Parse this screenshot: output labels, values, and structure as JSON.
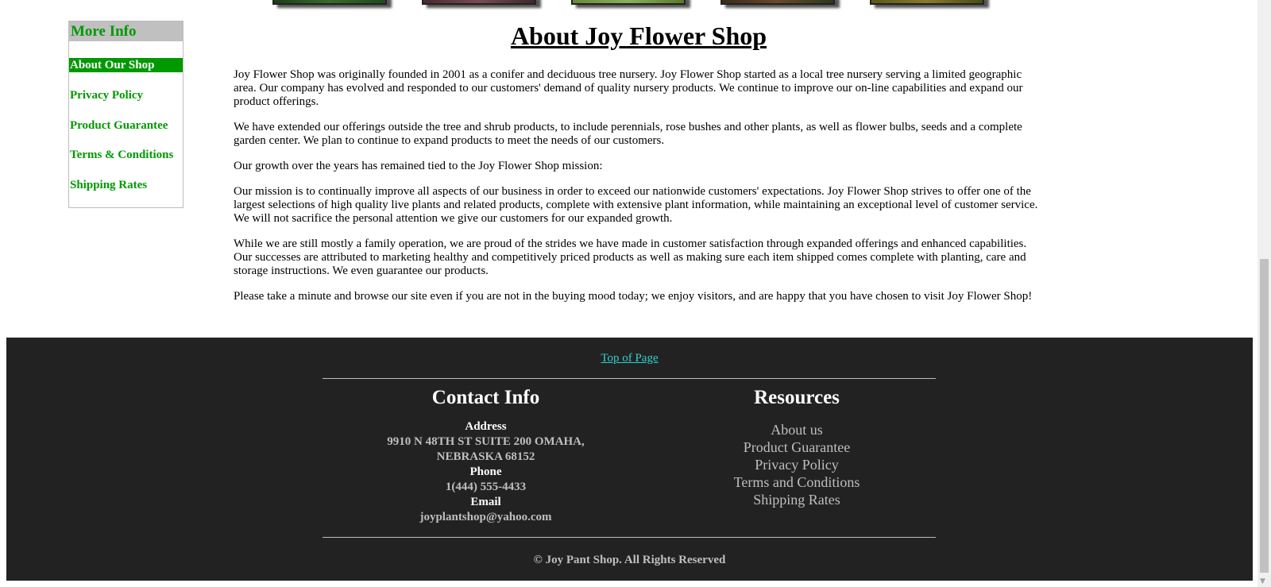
{
  "sidebar": {
    "title": "More Info",
    "items": [
      {
        "label": "About Our Shop",
        "active": true
      },
      {
        "label": "Privacy Policy"
      },
      {
        "label": "Product Guarantee"
      },
      {
        "label": "Terms & Conditions"
      },
      {
        "label": "Shipping Rates"
      }
    ]
  },
  "main": {
    "title": "About Joy Flower Shop",
    "paragraphs": [
      "Joy Flower Shop was originally founded in 2001 as a conifer and deciduous tree nursery. Joy Flower Shop started as a local tree nursery serving a limited geographic area. Our company has evolved and responded to our customers' demand of quality nursery products.  We continue to improve our on-line capabilities and expand our product offerings.",
      "We have extended our offerings outside the tree and shrub products, to include perennials, rose bushes and other plants, as well as flower bulbs, seeds and a complete garden center. We plan to continue to expand products to meet the needs of our customers.",
      "Our growth over the years has remained tied to the Joy Flower Shop mission:",
      "Our mission is to continually improve all aspects of our business in order to exceed our nationwide customers' expectations. Joy Flower Shop strives to offer one of the largest selections of high quality live plants and related products, complete with extensive plant information, while maintaining an exceptional level of customer service. We will not sacrifice the personal attention we give our customers for our expanded growth.",
      "While we are still mostly a family operation, we are proud of the strides we have made in customer satisfaction through expanded offerings and enhanced capabilities. Our successes are attributed to marketing healthy and competitively priced products as well as making sure each item shipped comes complete with planting, care and storage instructions. We even guarantee our products.",
      "Please take a minute and browse our site even if you are not in the buying mood today; we enjoy visitors, and are happy that you have chosen to visit Joy Flower Shop!"
    ]
  },
  "footer": {
    "top_link": "Top of Page",
    "contact": {
      "heading": "Contact Info",
      "address_label": "Address",
      "address_line1": "9910 N 48TH ST SUITE 200 OMAHA,",
      "address_line2": "NEBRASKA 68152",
      "phone_label": "Phone",
      "phone": "1(444) 555-4433",
      "email_label": "Email",
      "email": "joyplantshop@yahoo.com"
    },
    "resources": {
      "heading": "Resources",
      "links": [
        "About us",
        "Product Guarantee",
        "Privacy Policy",
        "Terms and Conditions",
        "Shipping Rates"
      ]
    },
    "copyright": "© Joy Pant Shop. All Rights Reserved"
  },
  "colors": {
    "accent_green": "#009900",
    "footer_bg": "#222222",
    "link_cyan": "#2fd2d2"
  }
}
